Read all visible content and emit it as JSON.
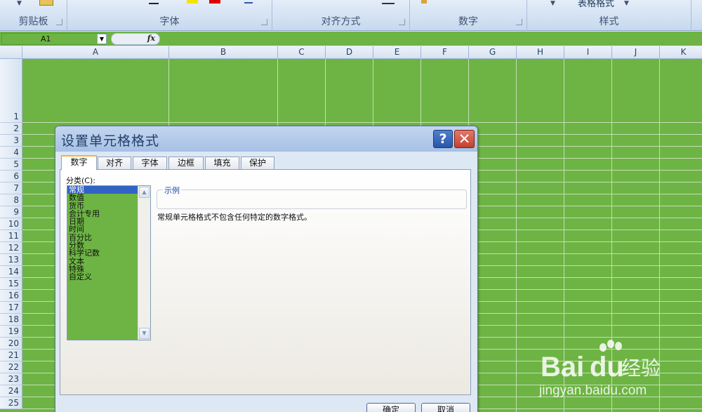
{
  "ribbon": {
    "groups": [
      {
        "label": "剪贴板"
      },
      {
        "label": "字体"
      },
      {
        "label": "对齐方式"
      },
      {
        "label": "数字"
      },
      {
        "label": "样式"
      }
    ],
    "styles_button": "表格格式"
  },
  "formula_bar": {
    "name_box": "A1",
    "fx": "fx",
    "formula": ""
  },
  "sheet": {
    "fill_color": "#6db444",
    "columns": [
      "A",
      "B",
      "C",
      "D",
      "E",
      "F",
      "G",
      "H",
      "I",
      "J",
      "K"
    ],
    "rows": [
      "1",
      "2",
      "3",
      "4",
      "5",
      "6",
      "7",
      "8",
      "9",
      "10",
      "11",
      "12",
      "13",
      "14",
      "15",
      "16",
      "17",
      "18",
      "19",
      "20",
      "21",
      "22",
      "23",
      "24",
      "25"
    ]
  },
  "dialog": {
    "title": "设置单元格格式",
    "help_glyph": "?",
    "close_glyph": "✕",
    "tabs": [
      "数字",
      "对齐",
      "字体",
      "边框",
      "填充",
      "保护"
    ],
    "active_tab": "数字",
    "category_label": "分类(C):",
    "categories": [
      "常规",
      "数值",
      "货币",
      "会计专用",
      "日期",
      "时间",
      "百分比",
      "分数",
      "科学记数",
      "文本",
      "特殊",
      "自定义"
    ],
    "selected_category": "常规",
    "sample_label": "示例",
    "sample_value": "",
    "description": "常规单元格格式不包含任何特定的数字格式。",
    "ok_label": "确定",
    "cancel_label": "取消"
  },
  "watermark": {
    "brand_prefix": "Bai",
    "brand_suffix": "du",
    "brand_cn": "经验",
    "url": "jingyan.baidu.com"
  }
}
